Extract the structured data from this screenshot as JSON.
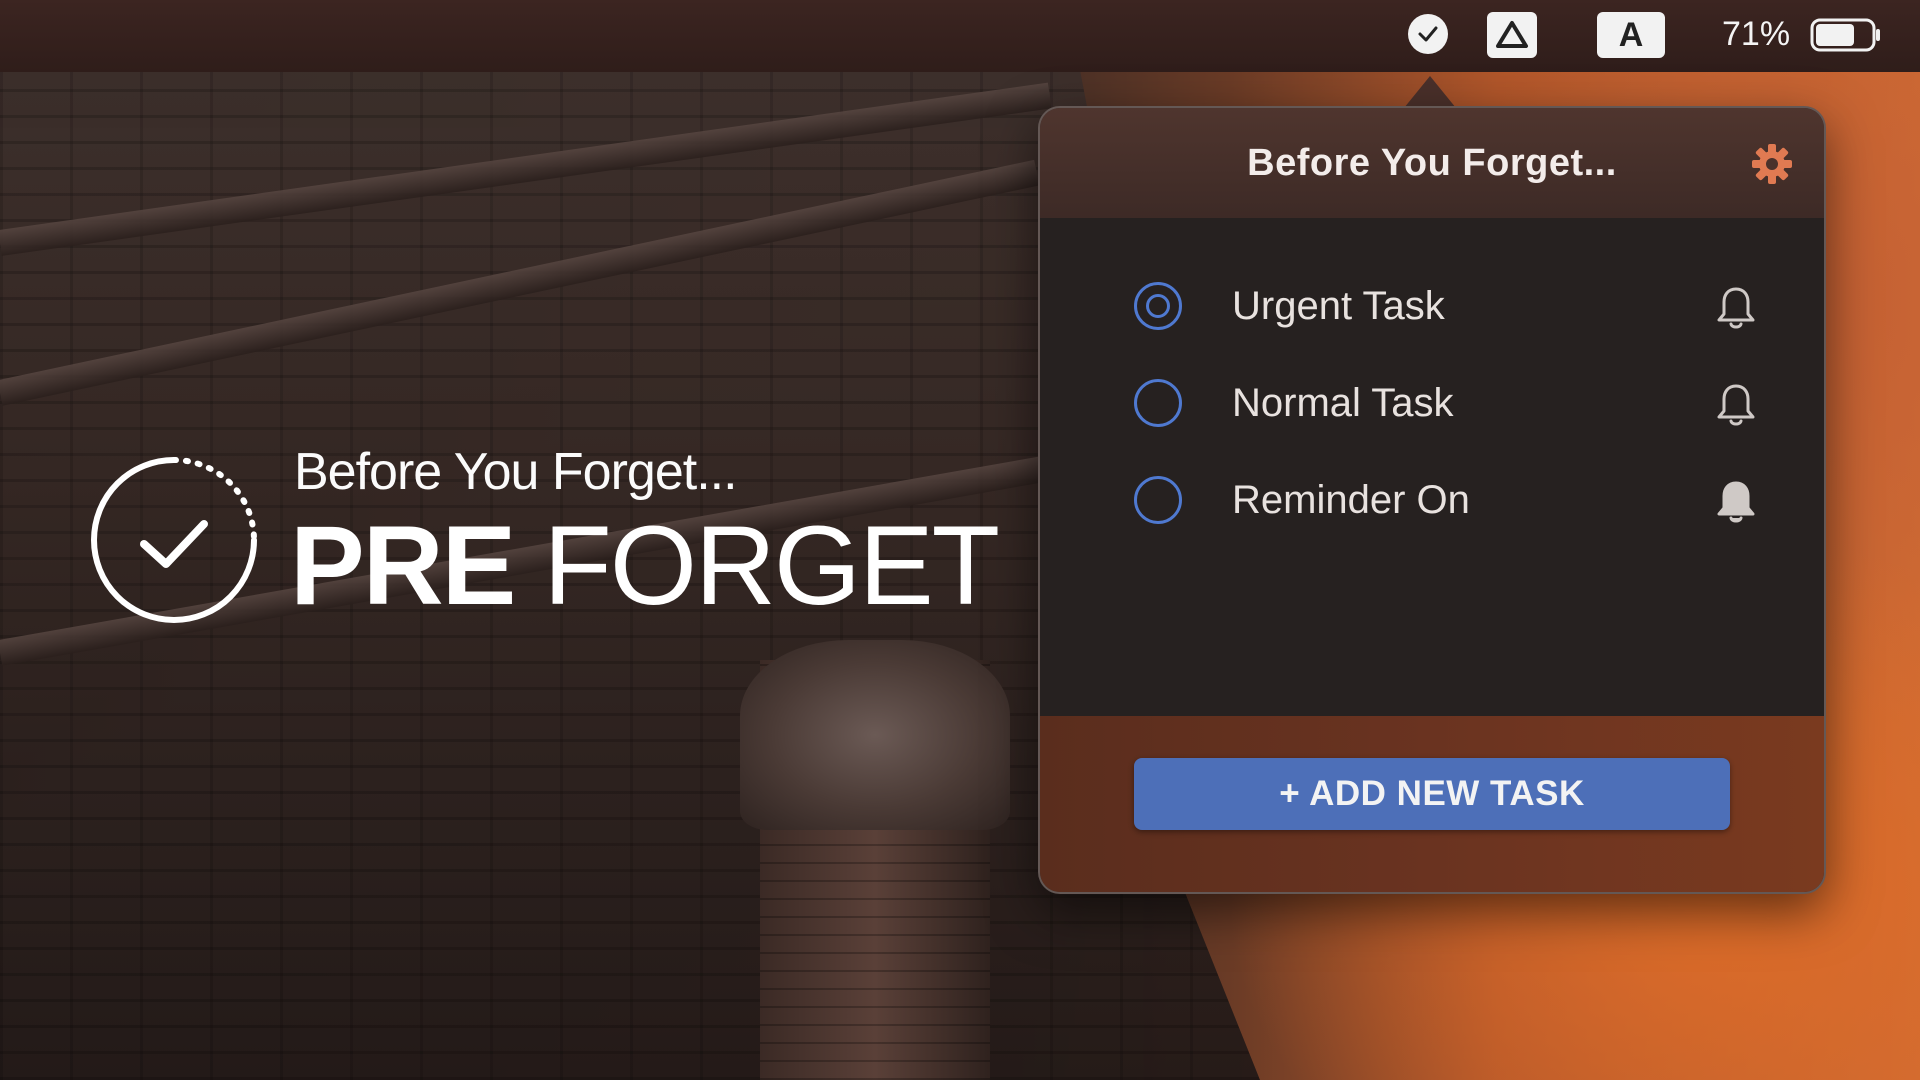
{
  "menubar": {
    "battery_percent": "71%",
    "battery_level": 0.71,
    "icons": [
      "checkmark-icon",
      "drive-icon",
      "input-source-icon",
      "battery-icon"
    ],
    "input_source_label": "A"
  },
  "popover": {
    "title": "Before You Forget...",
    "settings_icon": "gear-icon",
    "tasks": [
      {
        "label": "Urgent Task",
        "selected": true,
        "reminder": false
      },
      {
        "label": "Normal Task",
        "selected": false,
        "reminder": false
      },
      {
        "label": "Reminder On",
        "selected": false,
        "reminder": true
      }
    ],
    "add_button_label": "+ ADD NEW TASK",
    "colors": {
      "accent": "#4d6fb8",
      "radio": "#4f79d0",
      "footer": "#6a3320"
    }
  },
  "branding": {
    "tagline": "Before You Forget...",
    "name_bold": "PRE",
    "name_light": " FORGET",
    "logo_icon": "clock-check-icon"
  }
}
